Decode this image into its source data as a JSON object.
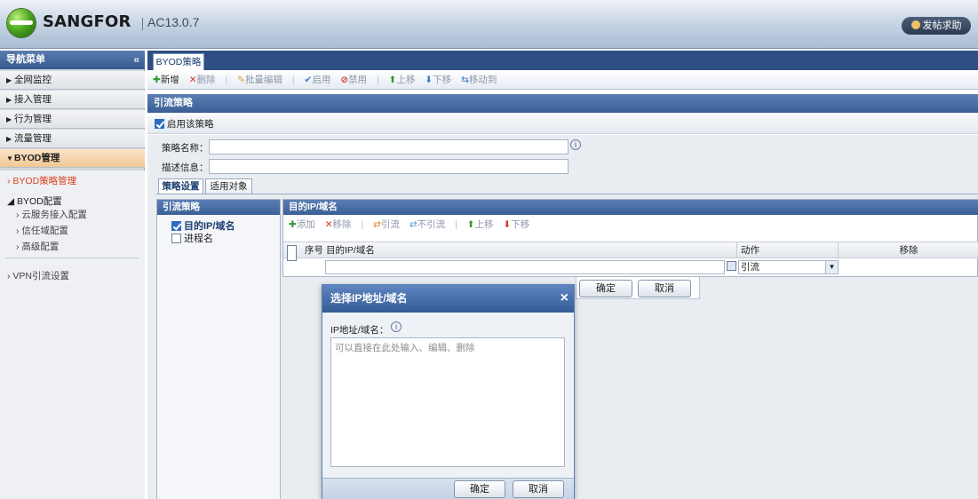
{
  "header": {
    "brand": "SANGFOR",
    "version": "AC13.0.7",
    "help_label": "发帖求助"
  },
  "sidebar": {
    "title": "导航菜单",
    "collapse_glyph": "«",
    "items": [
      {
        "label": "全网监控"
      },
      {
        "label": "接入管理"
      },
      {
        "label": "行为管理"
      },
      {
        "label": "流量管理"
      },
      {
        "label": "BYOD管理"
      }
    ],
    "sub": {
      "policy_mgmt": "BYOD策略管理",
      "config_head": "BYOD配置",
      "config_items": [
        "云服务接入配置",
        "信任域配置",
        "高级配置"
      ],
      "vpn": "VPN引流设置"
    }
  },
  "tabs": {
    "active": "BYOD策略"
  },
  "toolbar": {
    "add": "新增",
    "delete": "删除",
    "batch_edit": "批量编辑",
    "enable": "启用",
    "disable": "禁用",
    "move_up": "上移",
    "move_down": "下移",
    "move_to": "移动到"
  },
  "section": {
    "title": "引流策略"
  },
  "form": {
    "enable_label": "启用该策略",
    "name_label": "策略名称：",
    "desc_label": "描述信息：",
    "tab_settings": "策略设置",
    "tab_target": "适用对象"
  },
  "policy_col": {
    "head": "引流策略",
    "items": [
      "目的IP/域名",
      "进程名"
    ]
  },
  "dest": {
    "head": "目的IP/域名",
    "toolbar": {
      "add": "添加",
      "remove": "移除",
      "redirect": "引流",
      "no_redirect": "不引流",
      "up": "上移",
      "down": "下移"
    },
    "columns": {
      "index": "序号",
      "target": "目的IP/域名",
      "action": "动作",
      "remove": "移除"
    },
    "row_action": "引流"
  },
  "panel_buttons": {
    "ok": "确定",
    "cancel": "取消"
  },
  "dialog": {
    "title": "选择IP地址/域名",
    "close": "×",
    "field_label": "IP地址/域名：",
    "placeholder": "可以直接在此处输入、编辑、删除",
    "ok": "确定",
    "cancel": "取消"
  }
}
